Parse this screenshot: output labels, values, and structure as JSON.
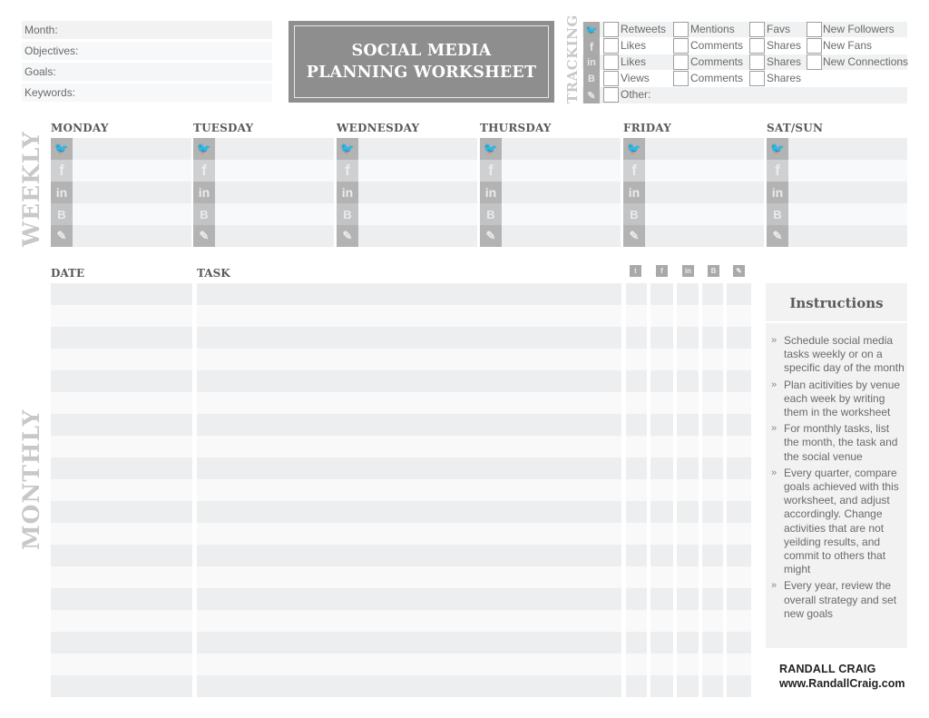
{
  "header": {
    "fields": [
      {
        "label": "Month:"
      },
      {
        "label": "Objectives:"
      },
      {
        "label": "Goals:"
      },
      {
        "label": "Keywords:"
      }
    ],
    "title_line1": "SOCIAL MEDIA",
    "title_line2": "PLANNING WORKSHEET"
  },
  "tracking": {
    "label": "TRACKING",
    "rows": [
      {
        "network": "twitter-icon",
        "glyph": "🐦",
        "items": [
          "Retweets",
          "Mentions",
          "Favs",
          "New Followers"
        ]
      },
      {
        "network": "facebook-icon",
        "glyph": "f",
        "items": [
          "Likes",
          "Comments",
          "Shares",
          "New Fans"
        ]
      },
      {
        "network": "linkedin-icon",
        "glyph": "in",
        "items": [
          "Likes",
          "Comments",
          "Shares",
          "New Connections"
        ]
      },
      {
        "network": "blogger-icon",
        "glyph": "B",
        "items": [
          "Views",
          "Comments",
          "Shares"
        ]
      },
      {
        "network": "pencil-icon",
        "glyph": "✎",
        "items": [
          "Other:"
        ]
      }
    ]
  },
  "weekly": {
    "label": "WEEKLY",
    "days": [
      "MONDAY",
      "TUESDAY",
      "WEDNESDAY",
      "THURSDAY",
      "FRIDAY",
      "SAT/SUN"
    ],
    "networks": [
      {
        "name": "twitter-icon",
        "glyph": "🐦"
      },
      {
        "name": "facebook-icon",
        "glyph": "f"
      },
      {
        "name": "linkedin-icon",
        "glyph": "in"
      },
      {
        "name": "blogger-icon",
        "glyph": "B"
      },
      {
        "name": "pencil-icon",
        "glyph": "✎"
      }
    ]
  },
  "monthly": {
    "label": "MONTHLY",
    "date_header": "DATE",
    "task_header": "TASK",
    "row_count": 19,
    "networks": [
      {
        "name": "twitter-icon",
        "glyph": "t"
      },
      {
        "name": "facebook-icon",
        "glyph": "f"
      },
      {
        "name": "linkedin-icon",
        "glyph": "in"
      },
      {
        "name": "blogger-icon",
        "glyph": "B"
      },
      {
        "name": "pencil-icon",
        "glyph": "✎"
      }
    ]
  },
  "instructions": {
    "title": "Instructions",
    "items": [
      "Schedule social media tasks weekly or on a specific day of the month",
      "Plan acitivities by venue each week by writing them in the worksheet",
      "For monthly tasks, list the month, the task and the social venue",
      "Every quarter, compare goals achieved with this worksheet, and adjust accordingly. Change activities that are not yeilding results, and commit to others that might",
      "Every year, review the overall strategy and set new goals"
    ],
    "bullet": "»"
  },
  "author": {
    "name": "RANDALL CRAIG",
    "url": "www.RandallCraig.com"
  },
  "colors": {
    "title_bg": "#8e8e8e",
    "row_dark": "#eceef0",
    "row_light": "#f9f9fa",
    "icon_bg": "#b3b3b3",
    "section_label": "#c8c8c8"
  }
}
